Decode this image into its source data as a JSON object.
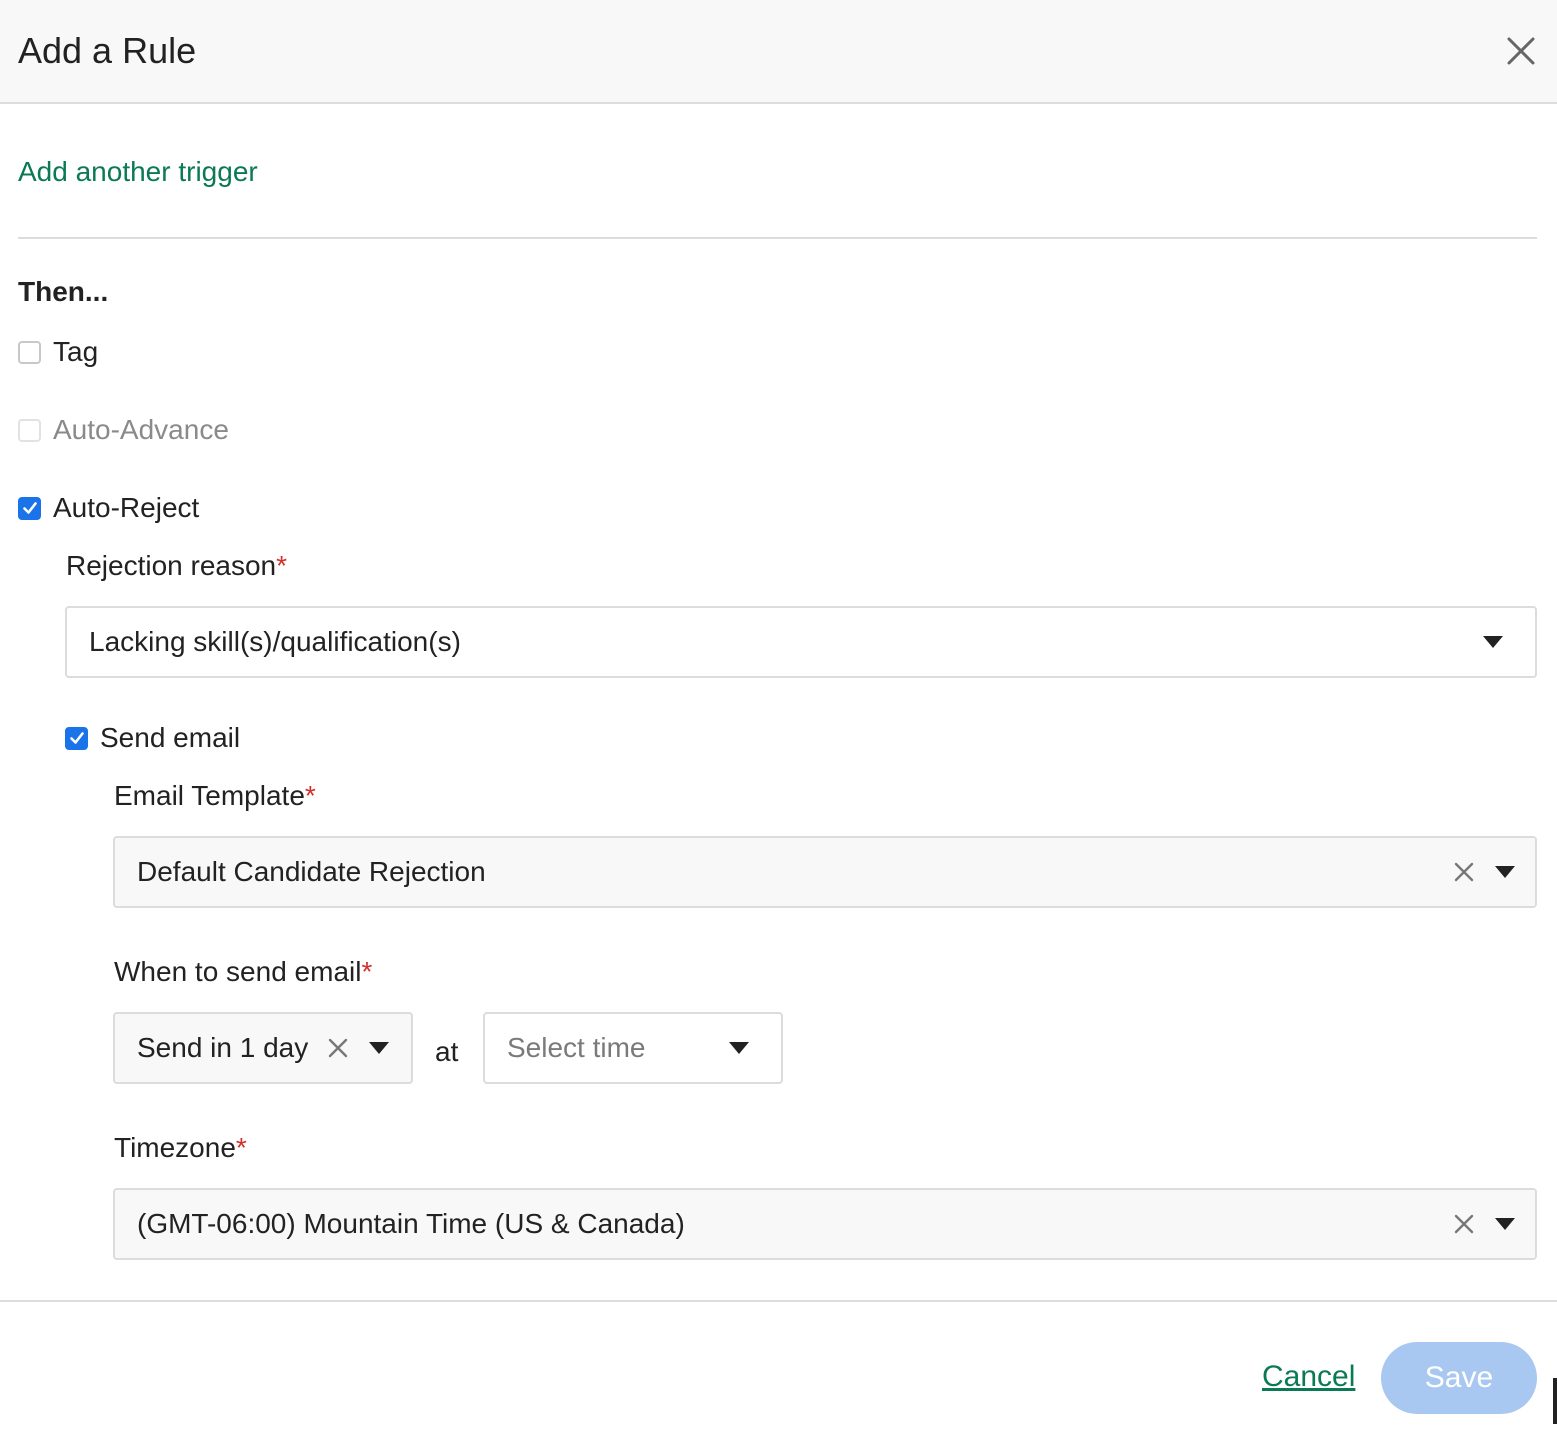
{
  "modal": {
    "title": "Add a Rule"
  },
  "triggers": {
    "add_another_label": "Add another trigger"
  },
  "actions": {
    "section_title": "Then...",
    "options": [
      {
        "label": "Tag",
        "checked": false,
        "disabled": false
      },
      {
        "label": "Auto-Advance",
        "checked": false,
        "disabled": true
      },
      {
        "label": "Auto-Reject",
        "checked": true,
        "disabled": false
      }
    ]
  },
  "auto_reject": {
    "rejection_reason": {
      "label": "Rejection reason",
      "required_mark": "*",
      "value": "Lacking skill(s)/qualification(s)"
    },
    "send_email": {
      "label": "Send email",
      "checked": true
    },
    "email_template": {
      "label": "Email Template",
      "required_mark": "*",
      "value": "Default Candidate Rejection"
    },
    "when_to_send": {
      "label": "When to send email",
      "required_mark": "*",
      "delay_value": "Send in 1 day",
      "at_label": "at",
      "time_placeholder": "Select time"
    },
    "timezone": {
      "label": "Timezone",
      "required_mark": "*",
      "value": "(GMT-06:00) Mountain Time (US & Canada)"
    }
  },
  "footer": {
    "cancel_label": "Cancel",
    "save_label": "Save"
  },
  "colors": {
    "link_green": "#0b7a54",
    "checkbox_blue": "#1a73e8",
    "save_disabled_blue": "#a9c8f1",
    "required_red": "#d0312d"
  }
}
